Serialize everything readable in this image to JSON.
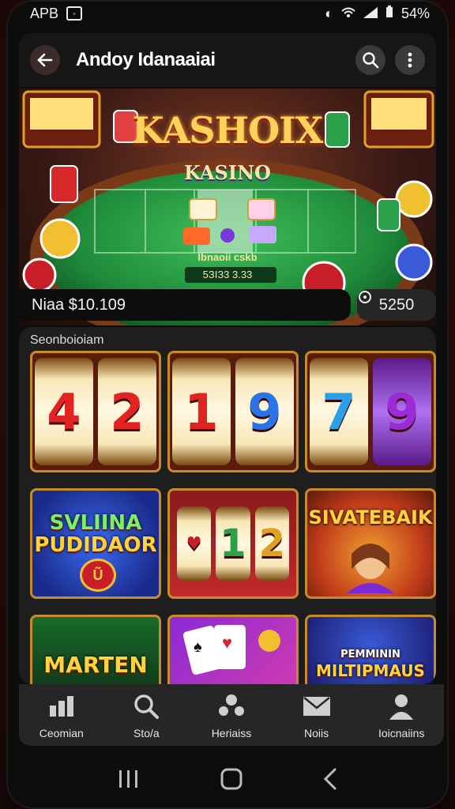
{
  "status_bar": {
    "carrier": "APB",
    "battery": "54%"
  },
  "app_bar": {
    "title": "Andoy Idanaaiai"
  },
  "hero": {
    "title": "KASHOIX",
    "subtitle": "KASINO",
    "table_text": "Ibnaoii cskb",
    "table_numbers": "5ЗIЗ3  3.33"
  },
  "balance": {
    "label": "Niaa $10.109",
    "value": "5250"
  },
  "section": {
    "label": "Seonboioiam"
  },
  "slots": [
    {
      "digits": [
        "4",
        "2"
      ],
      "colors": [
        "#e32222",
        "#e32222"
      ]
    },
    {
      "digits": [
        "1",
        "9"
      ],
      "colors": [
        "#e32222",
        "#2a74e8"
      ]
    },
    {
      "digits": [
        "7",
        "9"
      ],
      "colors": [
        "#2aa0e8",
        "#9c2ad6"
      ]
    }
  ],
  "tiles_row2": {
    "tile1_line1": "SVLIINA",
    "tile1_line2": "PUDIDAOR",
    "tile1_badge": "Ũ",
    "tile2_digits": [
      "1",
      "2"
    ],
    "tile3_line1": "SIVATEBAIK"
  },
  "tiles_row3": {
    "tile1_text": "MARTEN",
    "tile3_line1": "PEMMININ",
    "tile3_line2": "MILTIPMAUS"
  },
  "nav": [
    {
      "label": "Ceomian",
      "icon": "chart-icon"
    },
    {
      "label": "Sto/a",
      "icon": "search-icon"
    },
    {
      "label": "Heriaiss",
      "icon": "people-icon"
    },
    {
      "label": "Noiis",
      "icon": "mail-icon"
    },
    {
      "label": "Ioicnaiins",
      "icon": "person-icon"
    }
  ],
  "colors": {
    "accent_gold": "#c98b2a",
    "felt_green": "#1f8a3a",
    "panel": "#1e1e1e"
  }
}
